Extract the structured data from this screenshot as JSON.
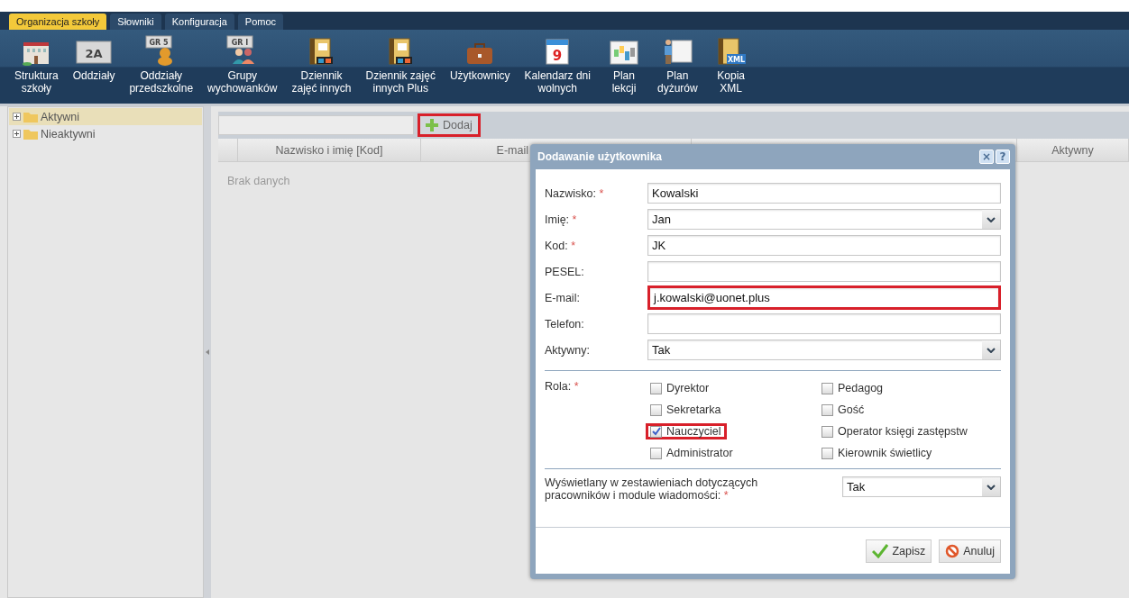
{
  "menu_tabs": [
    {
      "label": "Organizacja szkoły",
      "selected": true
    },
    {
      "label": "Słowniki",
      "selected": false
    },
    {
      "label": "Konfiguracja",
      "selected": false
    },
    {
      "label": "Pomoc",
      "selected": false
    }
  ],
  "toolbar": [
    {
      "lines": [
        "Struktura",
        "szkoły"
      ]
    },
    {
      "lines": [
        "Oddziały"
      ],
      "badge": "2A"
    },
    {
      "lines": [
        "Oddziały",
        "przedszkolne"
      ],
      "badge": "GR 5"
    },
    {
      "lines": [
        "Grupy",
        "wychowanków"
      ],
      "badge": "GR I"
    },
    {
      "lines": [
        "Dziennik",
        "zajęć innych"
      ]
    },
    {
      "lines": [
        "Dziennik zajęć",
        "innych Plus"
      ]
    },
    {
      "lines": [
        "Użytkownicy"
      ]
    },
    {
      "lines": [
        "Kalendarz dni",
        "wolnych"
      ],
      "badge": "9"
    },
    {
      "lines": [
        "Plan",
        "lekcji"
      ]
    },
    {
      "lines": [
        "Plan",
        "dyżurów"
      ]
    },
    {
      "lines": [
        "Kopia",
        "XML"
      ],
      "badge": "XML"
    }
  ],
  "tree": [
    {
      "label": "Aktywni",
      "selected": true,
      "expanded": false
    },
    {
      "label": "Nieaktywni",
      "selected": false,
      "expanded": false
    }
  ],
  "list": {
    "add_button": {
      "label": "Dodaj",
      "highlighted": true
    },
    "columns": [
      "Nazwisko i imię [Kod]",
      "E-mail",
      "Aktywny"
    ],
    "empty_text": "Brak danych"
  },
  "dialog": {
    "title": "Dodawanie użytkownika",
    "close": "×",
    "help": "?",
    "required_mark": "*",
    "fields": [
      {
        "label": "Nazwisko:",
        "required": true,
        "kind": "text",
        "value": "Kowalski",
        "highlighted": false
      },
      {
        "label": "Imię:",
        "required": true,
        "kind": "select",
        "value": "Jan",
        "highlighted": false
      },
      {
        "label": "Kod:",
        "required": true,
        "kind": "text",
        "value": "JK",
        "highlighted": false
      },
      {
        "label": "PESEL:",
        "kind": "text",
        "highlighted": false
      },
      {
        "label": "E-mail:",
        "kind": "text",
        "value": "j.kowalski@uonet.plus",
        "highlighted": true
      },
      {
        "label": "Telefon:",
        "kind": "text",
        "highlighted": false
      },
      {
        "label": "Aktywny:",
        "kind": "select",
        "value": "Tak",
        "highlighted": false
      }
    ],
    "roles_label": "Rola:",
    "roles_required": true,
    "roles": [
      {
        "label": "Dyrektor",
        "checked": false,
        "highlighted": false
      },
      {
        "label": "Pedagog",
        "checked": false,
        "highlighted": false
      },
      {
        "label": "Sekretarka",
        "checked": false,
        "highlighted": false
      },
      {
        "label": "Gość",
        "checked": false,
        "highlighted": false
      },
      {
        "label": "Nauczyciel",
        "checked": true,
        "highlighted": true
      },
      {
        "label": "Operator księgi zastępstw",
        "checked": false,
        "highlighted": false
      },
      {
        "label": "Administrator",
        "checked": false,
        "highlighted": false
      },
      {
        "label": "Kierownik świetlicy",
        "checked": false,
        "highlighted": false
      }
    ],
    "display": {
      "label": "Wyświetlany w zestawieniach dotyczących pracowników i module wiadomości:",
      "required": true,
      "value": "Tak"
    },
    "buttons": [
      {
        "label": "Zapisz",
        "kind": "save"
      },
      {
        "label": "Anuluj",
        "kind": "cancel"
      }
    ]
  }
}
